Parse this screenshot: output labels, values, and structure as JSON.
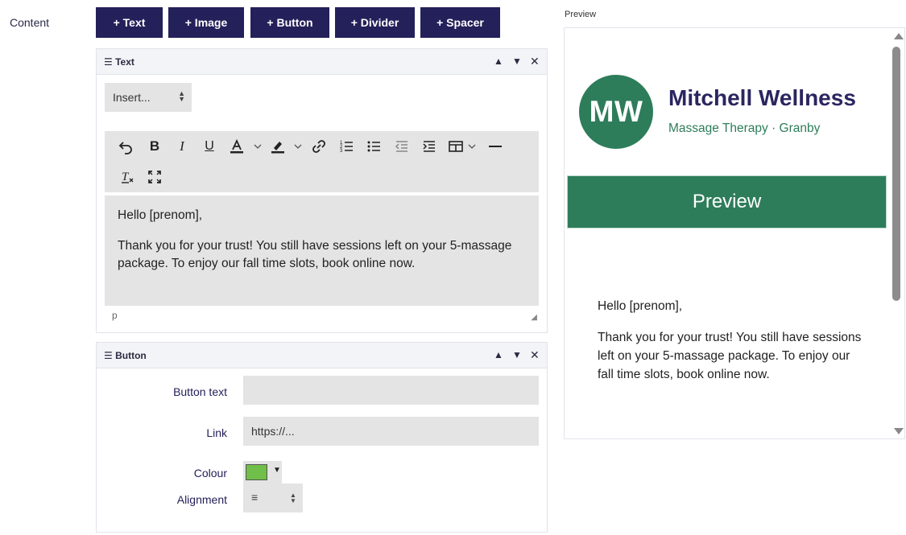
{
  "content_label": "Content",
  "add_buttons": {
    "text": "+ Text",
    "image": "+ Image",
    "button": "+ Button",
    "divider": "+ Divider",
    "spacer": "+ Spacer"
  },
  "text_block": {
    "title": "☰ Text",
    "controls": {
      "up": "▲",
      "down": "▼",
      "remove": "✕"
    },
    "insert_select": "Insert...",
    "editor": {
      "paragraphs": [
        "Hello [prenom],",
        "Thank you for your trust! You still have sessions left on your 5-massage package. To enjoy our fall time slots, book online now."
      ],
      "path": "p"
    }
  },
  "button_block": {
    "title": "☰ Button",
    "controls": {
      "up": "▲",
      "down": "▼",
      "remove": "✕"
    },
    "labels": {
      "button_text": "Button text",
      "link": "Link",
      "colour": "Colour",
      "alignment": "Alignment"
    },
    "button_text_value": "",
    "link_placeholder": "https://...",
    "colour_value": "#6fbf4a",
    "alignment_icon": "≡"
  },
  "preview": {
    "label": "Preview",
    "logo_initials": "MW",
    "brand_name": "Mitchell Wellness",
    "brand_subtitle": "Massage Therapy · Granby",
    "banner_text": "Preview",
    "body": [
      "Hello [prenom],",
      "Thank you for your trust! You still have sessions left on your 5-massage package. To enjoy our fall time slots, book online now."
    ]
  },
  "colors": {
    "brand_navy": "#24205a",
    "brand_green": "#2e7d5a",
    "field_gray": "#e4e4e4"
  }
}
